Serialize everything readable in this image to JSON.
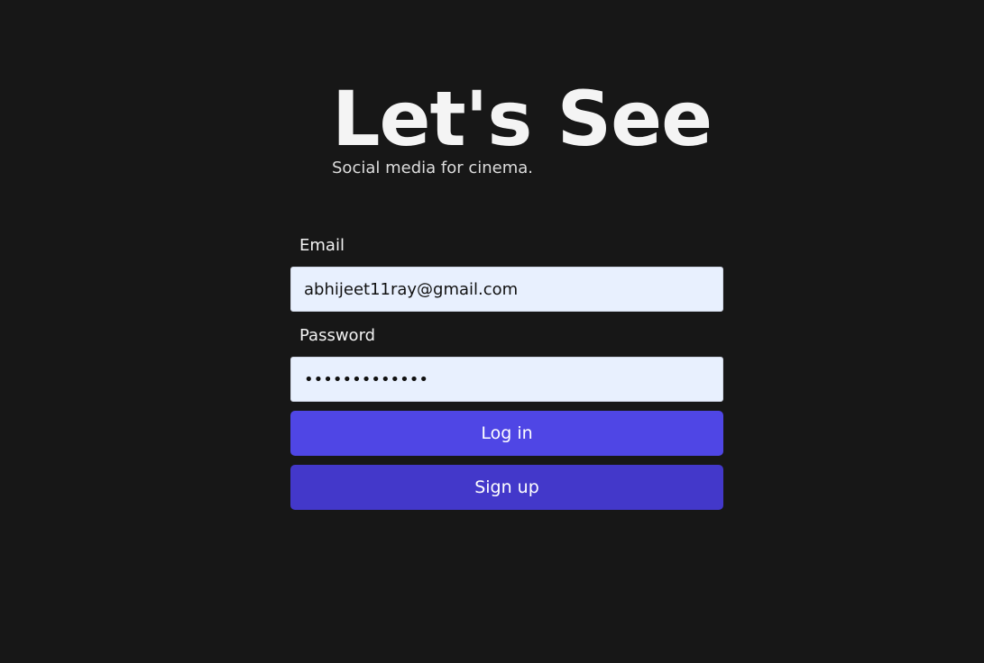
{
  "brand": {
    "title": "Let's See",
    "tagline": "Social media for cinema."
  },
  "form": {
    "email_label": "Email",
    "email_value": "abhijeet11ray@gmail.com",
    "password_label": "Password",
    "password_value": "secretpass123",
    "login_label": "Log in",
    "signup_label": "Sign up"
  },
  "colors": {
    "background": "#171717",
    "input_background": "#e8f0fe",
    "login_button": "#4f46e5",
    "signup_button": "#4338ca"
  }
}
